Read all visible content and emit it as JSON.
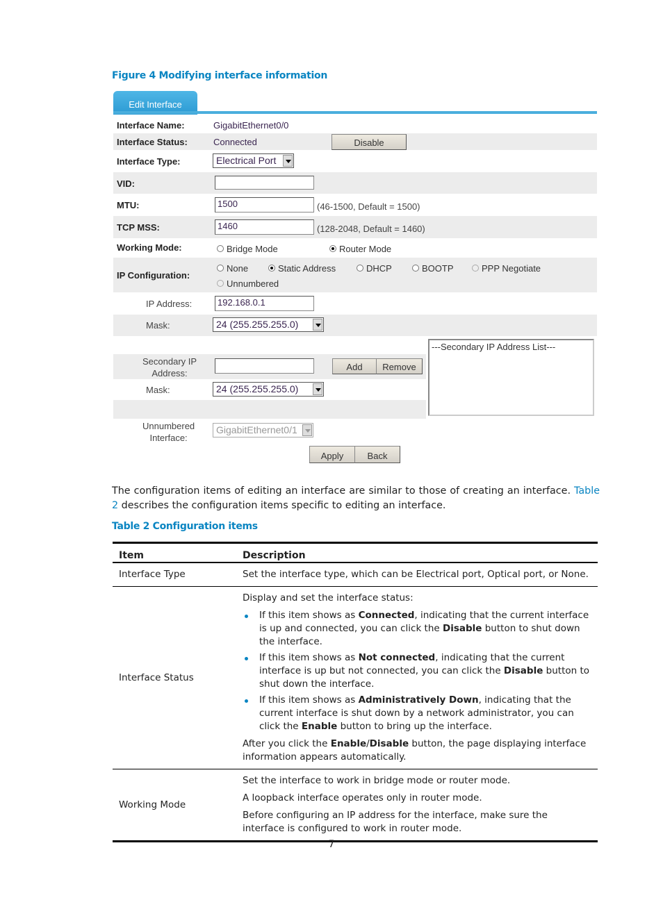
{
  "figure": {
    "caption": "Figure 4 Modifying interface information",
    "tab_label": "Edit Interface",
    "interface_name_label": "Interface Name:",
    "interface_name_value": "GigabitEthernet0/0",
    "interface_status_label": "Interface Status:",
    "interface_status_value": "Connected",
    "disable_button": "Disable",
    "interface_type_label": "Interface Type:",
    "interface_type_value": "Electrical Port",
    "vid_label": "VID:",
    "vid_value": "",
    "mtu_label": "MTU:",
    "mtu_value": "1500",
    "mtu_hint": "(46-1500, Default = 1500)",
    "tcp_mss_label": "TCP MSS:",
    "tcp_mss_value": "1460",
    "tcp_mss_hint": "(128-2048, Default = 1460)",
    "working_mode_label": "Working Mode:",
    "working_mode_options": [
      {
        "label": "Bridge Mode",
        "selected": false
      },
      {
        "label": "Router Mode",
        "selected": true
      }
    ],
    "ip_config_label": "IP Configuration:",
    "ip_config_options": [
      {
        "label": "None",
        "selected": false
      },
      {
        "label": "Static Address",
        "selected": true
      },
      {
        "label": "DHCP",
        "selected": false
      },
      {
        "label": "BOOTP",
        "selected": false
      },
      {
        "label": "PPP Negotiate",
        "selected": false,
        "disabled": true
      },
      {
        "label": "Unnumbered",
        "selected": false,
        "disabled": true
      }
    ],
    "ip_address_label": "IP Address:",
    "ip_address_value": "192.168.0.1",
    "mask_label": "Mask:",
    "mask_value": "24 (255.255.255.0)",
    "secondary_ip_label_1": "Secondary IP",
    "secondary_ip_label_2": "Address:",
    "secondary_ip_value": "",
    "add_button": "Add",
    "remove_button": "Remove",
    "secondary_mask_label": "Mask:",
    "secondary_mask_value": "24 (255.255.255.0)",
    "secondary_list_header": "---Secondary IP Address List---",
    "unnumbered_label_1": "Unnumbered",
    "unnumbered_label_2": "Interface:",
    "unnumbered_value": "GigabitEthernet0/1",
    "apply_button": "Apply",
    "back_button": "Back"
  },
  "paragraph": {
    "text_before": "The configuration items of editing an interface are similar to those of creating an interface. ",
    "link": "Table 2",
    "text_after": " describes the configuration items specific to editing an interface."
  },
  "table": {
    "caption": "Table 2 Configuration items",
    "headers": [
      "Item",
      "Description"
    ],
    "rows": {
      "interface_type": {
        "item": "Interface Type",
        "desc": "Set the interface type, which can be Electrical port, Optical port, or None."
      },
      "interface_status": {
        "item": "Interface Status",
        "intro": "Display and set the interface status:",
        "bullets": [
          {
            "pre": "If this item shows as ",
            "bold": "Connected",
            "mid": ", indicating that the current interface is up and connected, you can click the ",
            "bold2": "Disable",
            "post": " button to shut down the interface."
          },
          {
            "pre": "If this item shows as ",
            "bold": "Not connected",
            "mid": ", indicating that the current interface is up but not connected, you can click the ",
            "bold2": "Disable",
            "post": " button to shut down the interface."
          },
          {
            "pre": "If this item shows as ",
            "bold": "Administratively Down",
            "mid": ", indicating that the current interface is shut down by a network administrator, you can click the ",
            "bold2": "Enable",
            "post": " button to bring up the interface."
          }
        ],
        "after_pre": "After you click the ",
        "after_bold1": "Enable",
        "after_slash": "/",
        "after_bold2": "Disable",
        "after_post": " button, the page displaying interface information appears automatically."
      },
      "working_mode": {
        "item": "Working Mode",
        "lines": [
          "Set the interface to work in bridge mode or router mode.",
          "A loopback interface operates only in router mode.",
          "Before configuring an IP address for the interface, make sure the interface is configured to work in router mode."
        ]
      }
    }
  },
  "page_number": "7"
}
